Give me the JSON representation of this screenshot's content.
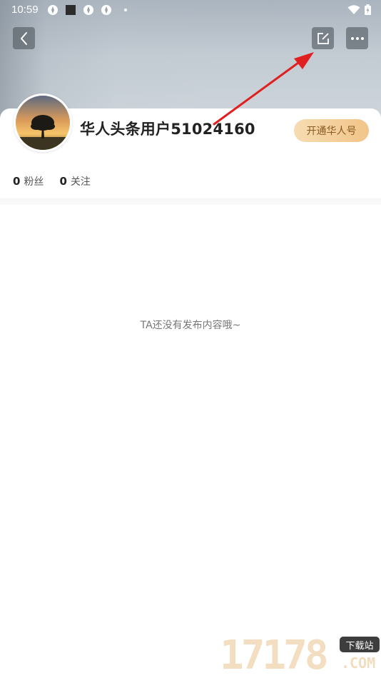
{
  "status_bar": {
    "time": "10:59"
  },
  "header": {
    "back_icon": "chevron-left-icon",
    "edit_icon": "edit-square-icon",
    "more_icon": "more-horizontal-icon"
  },
  "profile": {
    "username": "华人头条用户51024160",
    "open_button_label": "开通华人号",
    "followers_count": "0",
    "followers_label": "粉丝",
    "following_count": "0",
    "following_label": "关注"
  },
  "content": {
    "empty_message": "TA还没有发布内容哦~"
  },
  "watermark": {
    "digits": "17178",
    "tag": "下载站",
    "suffix": ".COM"
  },
  "colors": {
    "accent_button_start": "#f6dcb2",
    "accent_button_end": "#f2c489",
    "accent_text": "#8a5a20",
    "annotation_arrow": "#e02020"
  }
}
